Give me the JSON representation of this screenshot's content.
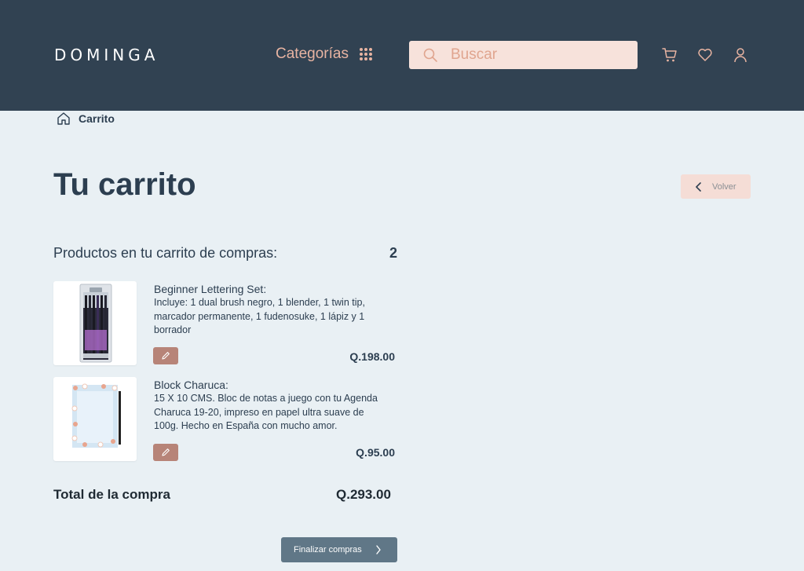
{
  "header": {
    "logo": "DOMINGA",
    "categories_label": "Categorías",
    "search_placeholder": "Buscar"
  },
  "breadcrumb": {
    "current": "Carrito"
  },
  "page": {
    "title": "Tu carrito",
    "back_label": "Volver",
    "section_title": "Productos en tu carrito de compras:",
    "item_count": "2"
  },
  "items": [
    {
      "name": "Beginner Lettering Set:",
      "description": "Incluye: 1 dual brush negro, 1 blender, 1 twin tip, marcador permanente, 1 fudenosuke, 1 lápiz y  1 borrador",
      "price": "Q.198.00"
    },
    {
      "name": "Block Charuca:",
      "description": "15 X 10 CMS. Bloc de notas a juego con tu Agenda Charuca 19-20, impreso en papel ultra suave de 100g. Hecho en España con mucho amor.",
      "price": "Q.95.00"
    }
  ],
  "summary": {
    "total_label": "Total de la compra",
    "total_value": "Q.293.00"
  },
  "checkout": {
    "label": "Finalizar compras"
  },
  "colors": {
    "header_bg": "#314252",
    "page_bg": "#e9f0f4",
    "accent_peach": "#e8b4a2",
    "edit_button": "#b78478",
    "checkout_button": "#607787"
  }
}
